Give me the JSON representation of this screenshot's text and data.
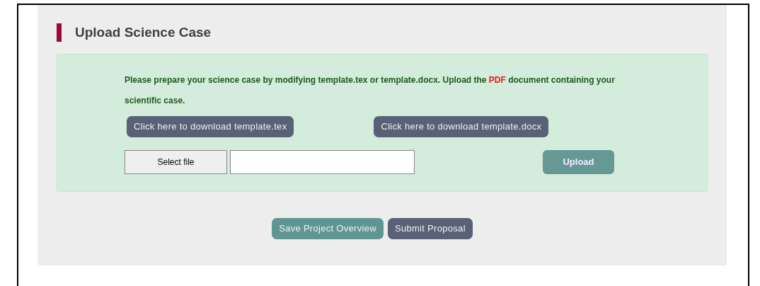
{
  "section": {
    "title": "Upload Science Case"
  },
  "instructions": {
    "before": "Please prepare your science case by modifying template.tex or template.docx. Upload the ",
    "highlight": "PDF",
    "after": " document containing your scientific case."
  },
  "download_buttons": [
    "Click here to download template.tex",
    "Click here to download template.docx"
  ],
  "file_picker": {
    "button": "Select file"
  },
  "upload_button": "Upload",
  "actions": [
    {
      "label": "Save Project Overview",
      "kind": "secondary"
    },
    {
      "label": "Submit Proposal",
      "kind": "primary"
    }
  ]
}
